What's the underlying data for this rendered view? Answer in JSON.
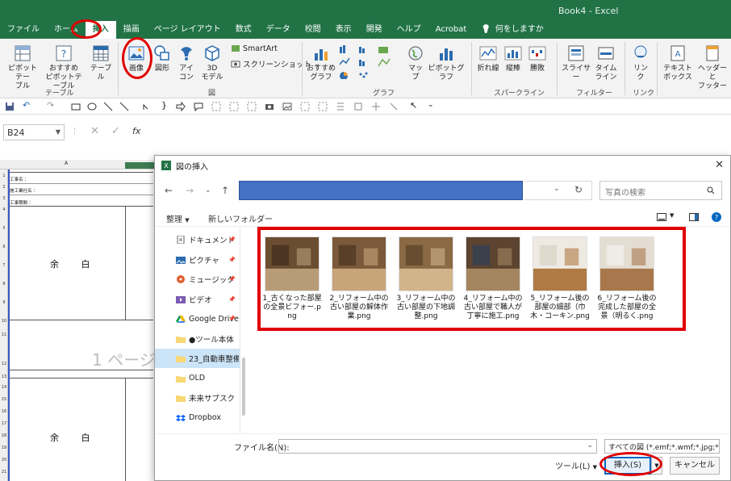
{
  "window": {
    "title": "Book4 - Excel"
  },
  "tabs": [
    "ファイル",
    "ホーム",
    "挿入",
    "描画",
    "ページ レイアウト",
    "数式",
    "データ",
    "校閲",
    "表示",
    "開発",
    "ヘルプ",
    "Acrobat"
  ],
  "active_tab": "挿入",
  "tell_me": "何をしますか",
  "ribbon": {
    "table_group": {
      "label": "テーブル",
      "pivot": [
        "ピボットテー",
        "ブル"
      ],
      "recommended_pivot": [
        "おすすめ",
        "ピボットテーブル"
      ],
      "table": "テーブル"
    },
    "illustrations": {
      "label": "図",
      "image": "画像",
      "shapes": "図形",
      "icons": [
        "アイ",
        "コン"
      ],
      "models3d": [
        "3D",
        "モデル"
      ],
      "smartart": "SmartArt",
      "screenshot": "スクリーンショット"
    },
    "charts": {
      "label": "グラフ",
      "recommended": [
        "おすすめ",
        "グラフ"
      ],
      "map": "マップ",
      "pivot_chart": "ピボットグラフ"
    },
    "sparklines": {
      "label": "スパークライン",
      "line": "折れ線",
      "column": "縦棒",
      "winloss": "勝敗"
    },
    "filters": {
      "label": "フィルター",
      "slicer": "スライサー",
      "timeline": [
        "タイム",
        "ライン"
      ]
    },
    "links": {
      "label": "リンク",
      "link": [
        "リン",
        "ク"
      ]
    },
    "text": {
      "textbox": [
        "テキスト",
        "ボックス"
      ],
      "header_footer": [
        "ヘッダーと",
        "フッター"
      ]
    }
  },
  "formula_bar": {
    "name_box": "B24",
    "fx": "fx"
  },
  "sheet": {
    "column_a": "A",
    "rows": [
      "1",
      "2",
      "3",
      "4",
      "5",
      "6",
      "7",
      "8",
      "9",
      "10",
      "11",
      "12",
      "13",
      "14",
      "15",
      "16",
      "17",
      "18",
      "19",
      "20",
      "21",
      "22"
    ],
    "labels": [
      "工事名 ：",
      "施工業社名 ：",
      "工事期間 ："
    ],
    "yohaku1": "余 白",
    "yohaku2": "余 白",
    "page_watermark": "1 ページ"
  },
  "dialog": {
    "title": "図の挿入",
    "search_placeholder": "写真の検索",
    "organize": "整理",
    "new_folder": "新しいフォルダー",
    "nav": [
      {
        "label": "ドキュメント",
        "icon": "document-icon",
        "pinned": true
      },
      {
        "label": "ピクチャ",
        "icon": "pictures-icon",
        "pinned": true
      },
      {
        "label": "ミュージック",
        "icon": "music-icon",
        "pinned": true
      },
      {
        "label": "ビデオ",
        "icon": "video-icon",
        "pinned": true
      },
      {
        "label": "Google Drive",
        "icon": "google-drive-icon",
        "pinned": true
      },
      {
        "label": "●ツール本体",
        "icon": "folder-icon",
        "pinned": false
      },
      {
        "label": "23_自動車整備点",
        "icon": "folder-icon",
        "pinned": false
      },
      {
        "label": "OLD",
        "icon": "folder-icon",
        "pinned": false
      },
      {
        "label": "未来サブスク",
        "icon": "folder-icon",
        "pinned": false
      },
      {
        "label": "Dropbox",
        "icon": "dropbox-icon",
        "pinned": false
      }
    ],
    "selected_nav": 6,
    "files": [
      {
        "name": "1_古くなった部屋の全景ビフォー.png",
        "colors": [
          "#6b4e32",
          "#b89c78",
          "#3d2a1a"
        ]
      },
      {
        "name": "2_リフォーム中の古い部屋の解体作業.png",
        "colors": [
          "#7a5a3a",
          "#c7a47a",
          "#4a3521"
        ]
      },
      {
        "name": "3_リフォーム中の古い部屋の下地調整.png",
        "colors": [
          "#8a6a45",
          "#d1b48a",
          "#5a4128"
        ]
      },
      {
        "name": "4_リフォーム中の古い部屋で職人が丁寧に施工.png",
        "colors": [
          "#5c4430",
          "#a3865f",
          "#2e3f5a"
        ]
      },
      {
        "name": "5_リフォーム後の部屋の細部（巾木・コーキン.png",
        "colors": [
          "#eeeae2",
          "#b07a45",
          "#d8d2c6"
        ]
      },
      {
        "name": "6_リフォーム後の完成した部屋の全景（明るく.png",
        "colors": [
          "#e4ddd2",
          "#a8784c",
          "#f4f1ec"
        ]
      }
    ],
    "filename_label": "ファイル名(N):",
    "filename_value": "",
    "filetype": "すべての図 (*.emf;*.wmf;*.jpg;*.jp",
    "tools": "ツール(L)",
    "insert": "挿入(S)",
    "cancel": "キャンセル"
  },
  "colors": {
    "excel_green": "#217346",
    "highlight_red": "#e00000",
    "address_blue": "#4472c4"
  }
}
